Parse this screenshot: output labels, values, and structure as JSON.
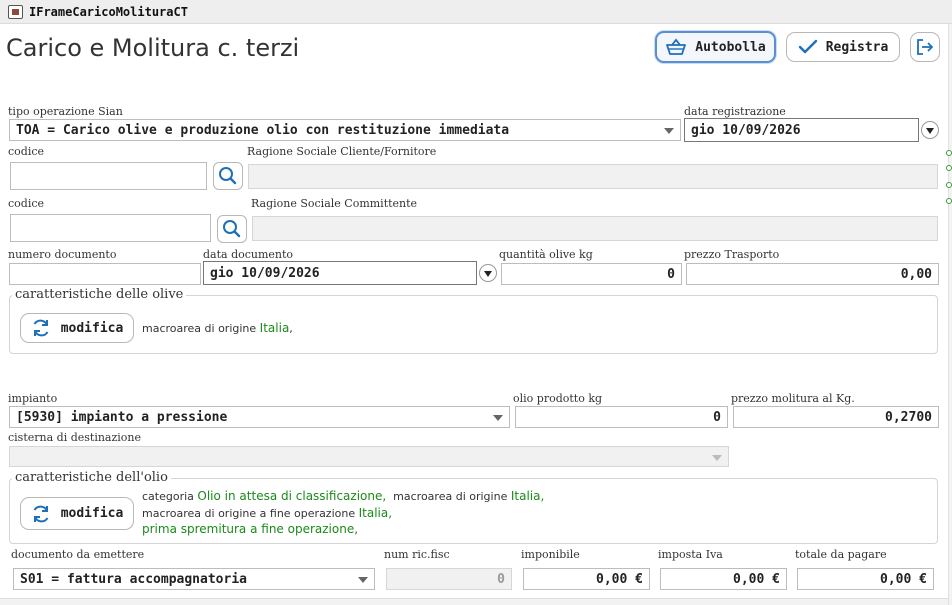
{
  "window": {
    "title": "IFrameCaricoMolituraCT"
  },
  "page": {
    "title": "Carico e Molitura c. terzi"
  },
  "toolbar": {
    "autobolla_label": "Autobolla",
    "registra_label": "Registra"
  },
  "sian": {
    "label": "tipo operazione Sian",
    "value": "TOA = Carico olive e produzione olio con restituzione immediata"
  },
  "data_registrazione": {
    "label": "data registrazione",
    "value": "gio 10/09/2026"
  },
  "cliente": {
    "codice_label": "codice",
    "codice_value": "",
    "ragione_label": "Ragione Sociale Cliente/Fornitore",
    "ragione_value": ""
  },
  "committente": {
    "codice_label": "codice",
    "codice_value": "",
    "ragione_label": "Ragione Sociale Committente",
    "ragione_value": ""
  },
  "documento": {
    "numero_label": "numero documento",
    "numero_value": "",
    "data_label": "data documento",
    "data_value": "gio 10/09/2026",
    "quantita_label": "quantità olive kg",
    "quantita_value": "0",
    "trasporto_label": "prezzo Trasporto",
    "trasporto_value": "0,00"
  },
  "olive_group": {
    "title": "caratteristiche delle olive",
    "modifica_label": "modifica",
    "macroarea_label": "macroarea di origine",
    "macroarea_value": "Italia",
    "macroarea_sep": ","
  },
  "impianto": {
    "label": "impianto",
    "value": "[5930] impianto a pressione",
    "olio_label": "olio prodotto kg",
    "olio_value": "0",
    "prezzo_label": "prezzo molitura al Kg.",
    "prezzo_value": "0,2700",
    "cisterna_label": "cisterna di destinazione",
    "cisterna_value": ""
  },
  "olio_group": {
    "title": "caratteristiche dell'olio",
    "modifica_label": "modifica",
    "categoria_label": "categoria",
    "categoria_value": "Olio in attesa di classificazione,",
    "macroarea_label": "macroarea di origine",
    "macroarea_value": "Italia,",
    "macroarea_fine_label": "macroarea di origine a fine operazione",
    "macroarea_fine_value": "Italia,",
    "spremitura_value": "prima spremitura a fine operazione,"
  },
  "footer": {
    "doc_label": "documento da emettere",
    "doc_value": "S01 = fattura accompagnatoria",
    "ric_label": "num ric.fisc",
    "ric_value": "0",
    "imponibile_label": "imponibile",
    "imponibile_value": "0,00 €",
    "iva_label": "imposta Iva",
    "iva_value": "0,00 €",
    "totale_label": "totale da pagare",
    "totale_value": "0,00 €"
  },
  "colors": {
    "accent": "#5b8fd0",
    "icon_blue": "#1f6fb8",
    "green_text": "#1a8a1a"
  },
  "icons": [
    "app-icon",
    "basket-icon",
    "check-icon",
    "exit-icon",
    "search-icon",
    "refresh-icon",
    "chevron-down-icon"
  ]
}
